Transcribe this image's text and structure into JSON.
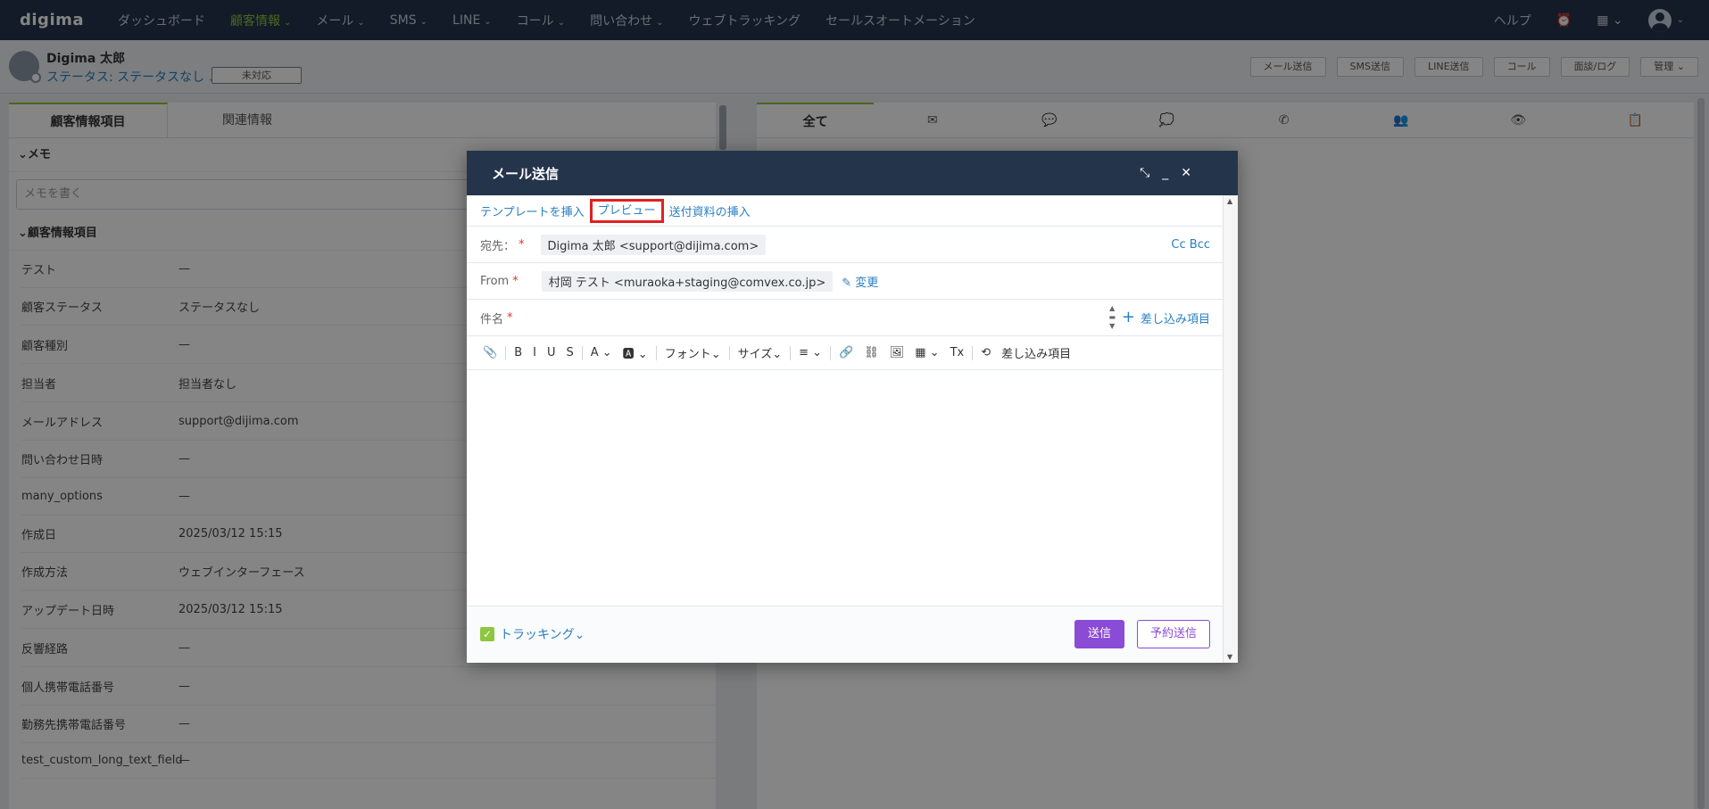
{
  "topnav": {
    "logo": "digima",
    "items": [
      {
        "label": "ダッシュボード",
        "chev": false,
        "active": false
      },
      {
        "label": "顧客情報",
        "chev": true,
        "active": true
      },
      {
        "label": "メール",
        "chev": true,
        "active": false
      },
      {
        "label": "SMS",
        "chev": true,
        "active": false
      },
      {
        "label": "LINE",
        "chev": true,
        "active": false
      },
      {
        "label": "コール",
        "chev": true,
        "active": false
      },
      {
        "label": "問い合わせ",
        "chev": true,
        "active": false
      },
      {
        "label": "ウェブトラッキング",
        "chev": false,
        "active": false
      },
      {
        "label": "セールスオートメーション",
        "chev": false,
        "active": false
      }
    ],
    "help": "ヘルプ",
    "chev": "⌄"
  },
  "customer": {
    "name": "Digima 太郎",
    "status": "ステータス: ステータスなし",
    "status_box": "未対応",
    "actions": [
      "メール送信",
      "SMS送信",
      "LINE送信",
      "コール",
      "面談/ログ",
      "管理 ⌄"
    ]
  },
  "left": {
    "tabs": [
      "顧客情報項目",
      "関連情報"
    ],
    "memo_head": "⌄メモ",
    "memo_placeholder": "メモを書く",
    "fields_head": "⌄顧客情報項目",
    "fields": [
      {
        "label": "テスト",
        "value": "—"
      },
      {
        "label": "顧客ステータス",
        "value": "ステータスなし"
      },
      {
        "label": "顧客種別",
        "value": "—"
      },
      {
        "label": "担当者",
        "value": "担当者なし"
      },
      {
        "label": "メールアドレス",
        "value": "support@dijima.com"
      },
      {
        "label": "問い合わせ日時",
        "value": "—"
      },
      {
        "label": "many_options",
        "value": "—"
      },
      {
        "label": "作成日",
        "value": "2025/03/12 15:15"
      },
      {
        "label": "作成方法",
        "value": "ウェブインターフェース"
      },
      {
        "label": "アップデート日時",
        "value": "2025/03/12 15:15"
      },
      {
        "label": "反響経路",
        "value": "—"
      },
      {
        "label": "個人携帯電話番号",
        "value": "—"
      },
      {
        "label": "勤務先携帯電話番号",
        "value": "—"
      },
      {
        "label": "test_custom_long_text_field",
        "value": "—"
      }
    ]
  },
  "right": {
    "tabs": [
      "全て",
      "✉",
      "💬",
      "💭",
      "✆",
      "👥",
      "👁",
      "📋"
    ]
  },
  "modal": {
    "title": "メール送信",
    "controls": [
      "⤡",
      "_",
      "✕"
    ],
    "toolbar_links": [
      "テンプレートを挿入",
      "プレビュー",
      "送付資料の挿入"
    ],
    "to_label": "宛先：",
    "to_value": "Digima 太郎 <support@dijima.com>",
    "cc_bcc": "Cc Bcc",
    "from_label": "From",
    "from_value": "村岡 テスト <muraoka+staging@comvex.co.jp>",
    "change_label": "✎ 変更",
    "subject_label": "件名",
    "insert_items": "差し込み項目",
    "editor_tools": [
      "📎",
      "B",
      "I",
      "U",
      "S",
      "A ⌄",
      "🅰 ⌄",
      "フォント⌄",
      "サイズ⌄",
      "≡ ⌄",
      "🔗",
      "⛓",
      "🖼",
      "▦ ⌄",
      "Tx",
      "⟲"
    ],
    "editor_insert": "差し込み項目",
    "tracking": "トラッキング⌄",
    "send": "送信",
    "schedule": "予約送信"
  }
}
